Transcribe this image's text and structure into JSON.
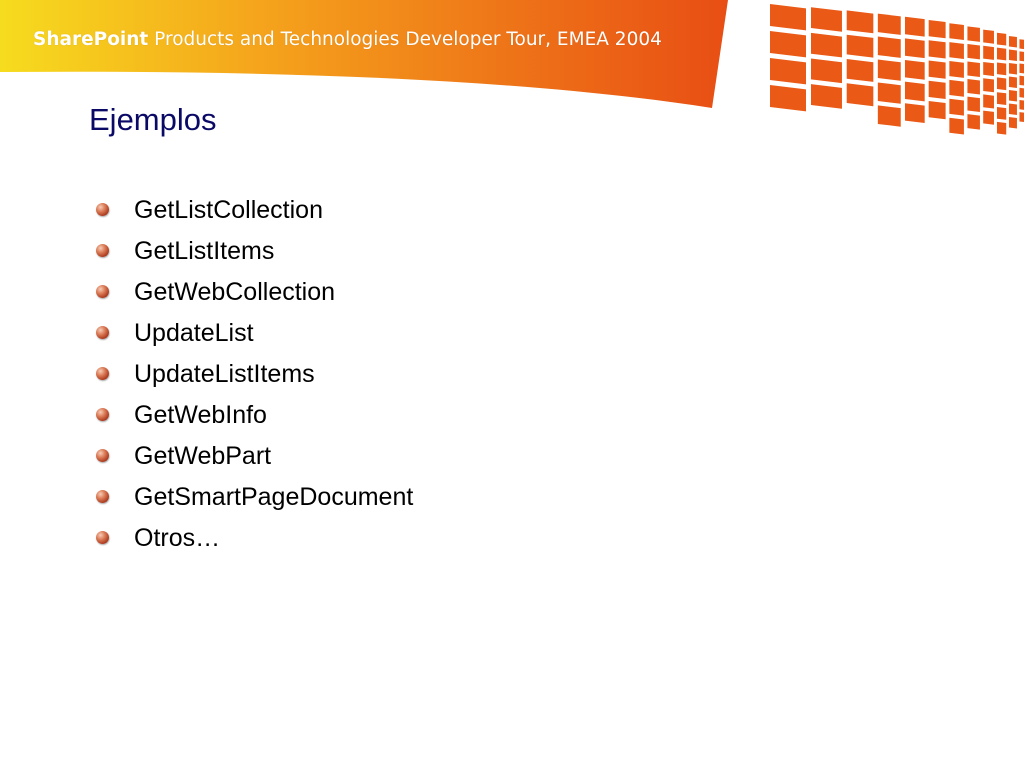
{
  "banner": {
    "brand": "SharePoint",
    "title_rest": " Products and Technologies Developer Tour, EMEA 2004"
  },
  "slide": {
    "title": "Ejemplos",
    "bullets": [
      "GetListCollection",
      "GetListItems",
      "GetWebCollection",
      "UpdateList",
      "UpdateListItems",
      "GetWebInfo",
      "GetWebPart",
      "GetSmartPageDocument",
      "Otros…"
    ]
  },
  "colors": {
    "banner_start": "#f6dc1e",
    "banner_end": "#e84e14",
    "title_text": "#0a0a66",
    "bullet": "#c4502e"
  }
}
